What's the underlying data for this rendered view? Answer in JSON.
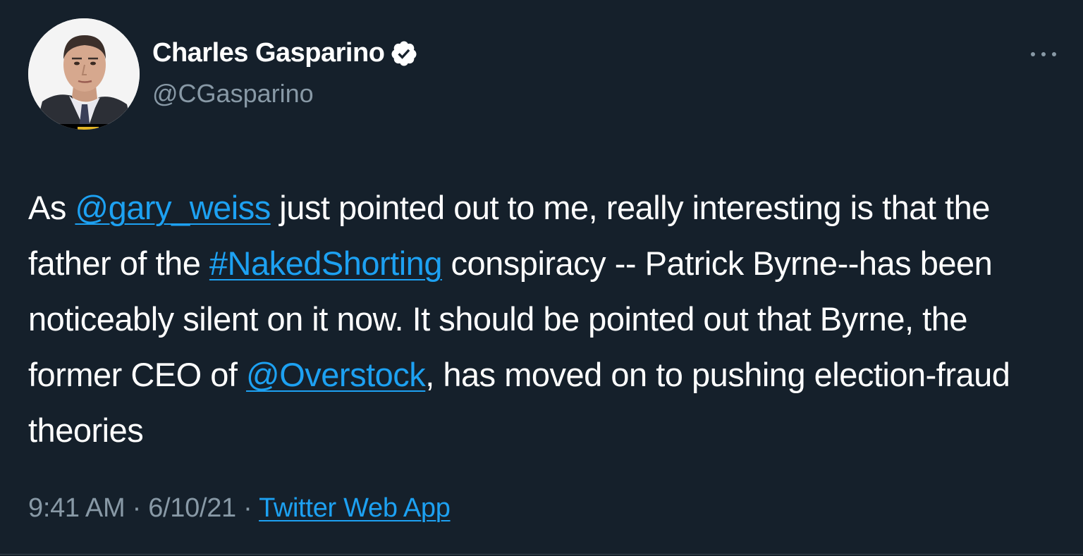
{
  "author": {
    "display_name": "Charles Gasparino",
    "handle": "@CGasparino",
    "verified": true,
    "avatar_icon": "person-photo"
  },
  "more_icon": "ellipsis-icon",
  "tweet": {
    "t1": "As ",
    "mention1": "@gary_weiss",
    "t2": " just pointed out to me, really interesting is that the father of the ",
    "hashtag": "#NakedShorting",
    "t3": " conspiracy -- Patrick Byrne--has been noticeably silent on it now. It should be pointed out that Byrne, the former CEO of ",
    "mention2": "@Overstock",
    "t4": ", has moved on to pushing election-fraud theories"
  },
  "meta": {
    "time": "9:41 AM",
    "sep1": " · ",
    "date": "6/10/21",
    "sep2": " · ",
    "source": "Twitter Web App"
  },
  "colors": {
    "background": "#15202b",
    "link": "#1da1f2",
    "secondary_text": "#8899a6",
    "verified_badge": "#ffffff"
  }
}
